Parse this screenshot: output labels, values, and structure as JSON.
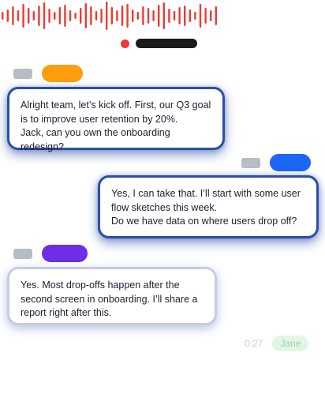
{
  "colors": {
    "waveform": "#ee3a34",
    "record_dot": "#ee3a34",
    "bubble_border": "#2a4fa6",
    "speaker_orange": "#ff9e0d",
    "speaker_blue": "#1e66f5",
    "speaker_purple": "#6d2ee8",
    "speaker_green": "#9ad2a6"
  },
  "messages": [
    {
      "speaker_color": "orange",
      "align": "left",
      "text": "Alright team, let’s kick off. First, our Q3 goal is to improve user retention by 20%.\nJack, can you own the onboarding redesign?"
    },
    {
      "speaker_color": "blue",
      "align": "right",
      "text": "Yes, I can take that. I’ll start with some user flow sketches this week.\n Do we have data on where users drop off?"
    },
    {
      "speaker_color": "purple",
      "align": "left",
      "text": "Yes. Most drop-offs happen after the second screen in onboarding. I’ll share a report right after this."
    }
  ],
  "pending": {
    "time": "0:27",
    "speaker": "Jane"
  }
}
